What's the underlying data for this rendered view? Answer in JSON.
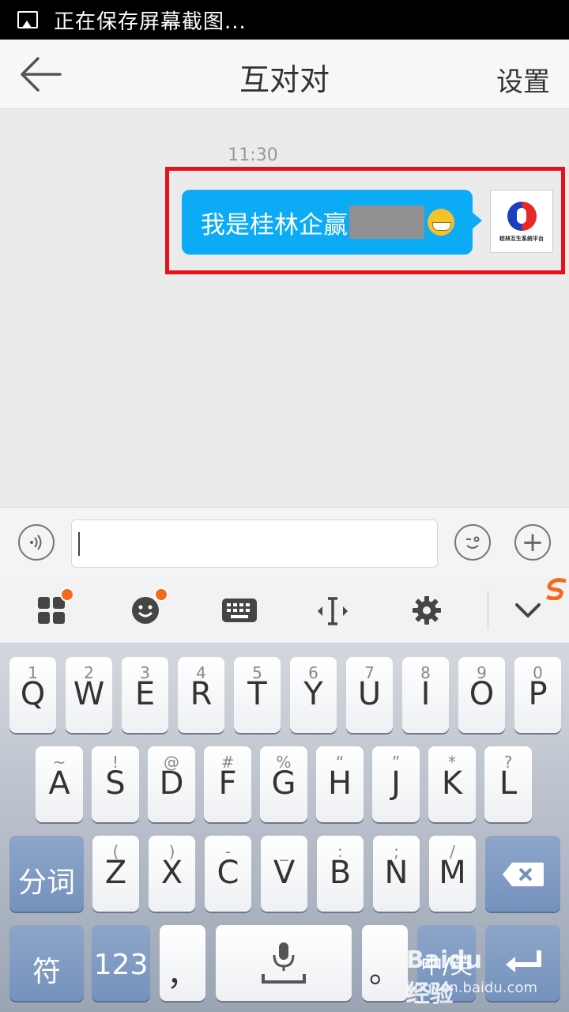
{
  "status_bar": {
    "text": "正在保存屏幕截图..."
  },
  "title_bar": {
    "title": "互对对",
    "settings": "设置"
  },
  "chat": {
    "time": "11:30",
    "message": "我是桂林企赢",
    "avatar_text": "桂林互生系统平台"
  },
  "keyboard": {
    "row1": [
      {
        "sub": "1",
        "main": "Q"
      },
      {
        "sub": "2",
        "main": "W"
      },
      {
        "sub": "3",
        "main": "E"
      },
      {
        "sub": "4",
        "main": "R"
      },
      {
        "sub": "5",
        "main": "T"
      },
      {
        "sub": "6",
        "main": "Y"
      },
      {
        "sub": "7",
        "main": "U"
      },
      {
        "sub": "8",
        "main": "I"
      },
      {
        "sub": "9",
        "main": "O"
      },
      {
        "sub": "0",
        "main": "P"
      }
    ],
    "row2": [
      {
        "sub": "~",
        "main": "A"
      },
      {
        "sub": "!",
        "main": "S"
      },
      {
        "sub": "@",
        "main": "D"
      },
      {
        "sub": "#",
        "main": "F"
      },
      {
        "sub": "%",
        "main": "G"
      },
      {
        "sub": "“",
        "main": "H"
      },
      {
        "sub": "”",
        "main": "J"
      },
      {
        "sub": "*",
        "main": "K"
      },
      {
        "sub": "?",
        "main": "L"
      }
    ],
    "row3": [
      {
        "sub": "(",
        "main": "Z"
      },
      {
        "sub": ")",
        "main": "X"
      },
      {
        "sub": "-",
        "main": "C"
      },
      {
        "sub": "_",
        "main": "V"
      },
      {
        "sub": ":",
        "main": "B"
      },
      {
        "sub": ";",
        "main": "N"
      },
      {
        "sub": "/",
        "main": "M"
      }
    ],
    "split_word": "分词",
    "symbol": "符",
    "numbers": "123",
    "comma": "，",
    "period": "。",
    "lang": "中/英"
  },
  "watermark": {
    "logo": "Baidu经验",
    "url": "jingyan.baidu.com"
  }
}
